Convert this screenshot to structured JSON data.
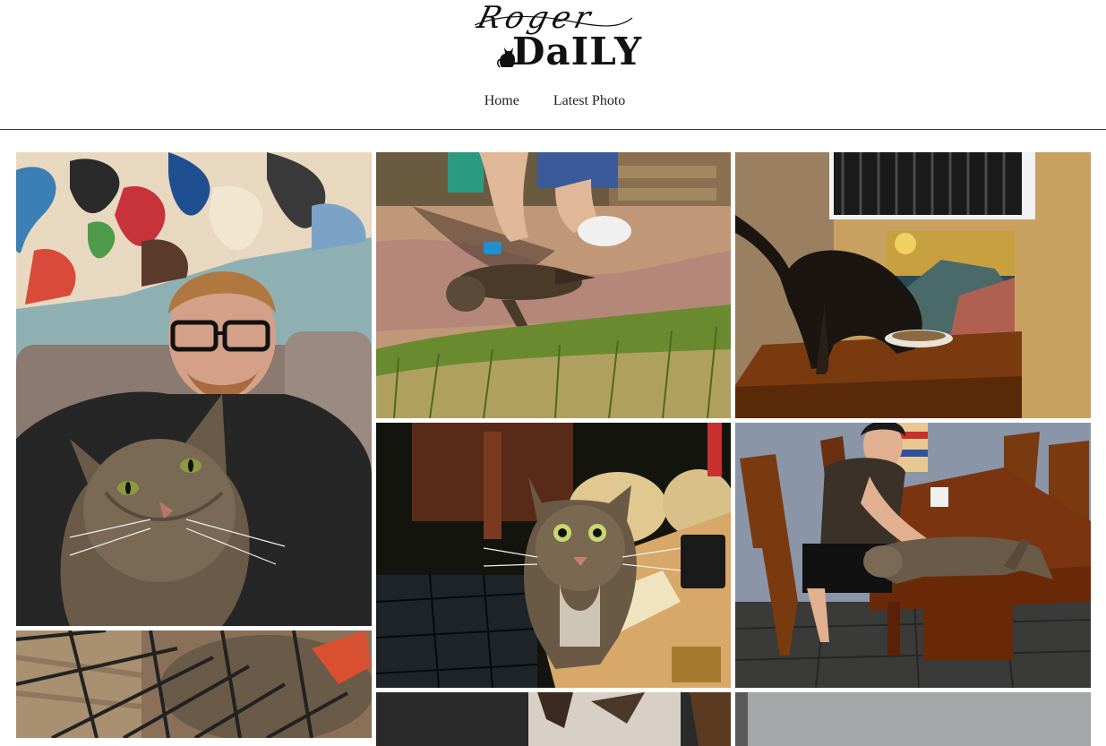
{
  "site": {
    "logo_script": "Roger",
    "logo_block": "DaILY"
  },
  "nav": {
    "items": [
      {
        "label": "Home"
      },
      {
        "label": "Latest Photo"
      }
    ]
  },
  "gallery": {
    "photos": [
      {
        "subject": "man-with-cat-selfie-photo"
      },
      {
        "subject": "cat-brushed-on-porch-photo"
      },
      {
        "subject": "cat-eating-on-table-photo"
      },
      {
        "subject": "cat-looking-up-photo"
      },
      {
        "subject": "man-petting-cat-on-table-photo"
      },
      {
        "subject": "cat-in-cage-photo"
      },
      {
        "subject": "cat-partial-photo"
      },
      {
        "subject": "gray-wall-partial-photo"
      }
    ]
  }
}
